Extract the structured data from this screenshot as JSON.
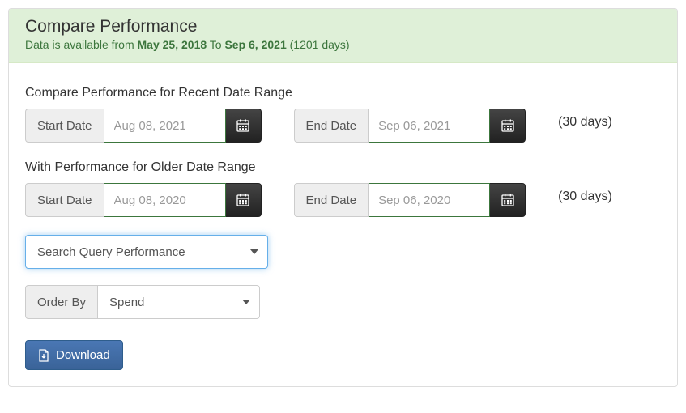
{
  "header": {
    "title": "Compare Performance",
    "data_prefix": "Data is available from ",
    "from_date": "May 25, 2018",
    "to_word": " To ",
    "to_date": "Sep 6, 2021",
    "days_suffix": " (1201 days)"
  },
  "recent": {
    "label": "Compare Performance for Recent Date Range",
    "start_label": "Start Date",
    "start_value": "Aug 08, 2021",
    "end_label": "End Date",
    "end_value": "Sep 06, 2021",
    "days": "(30 days)"
  },
  "older": {
    "label": "With Performance for Older Date Range",
    "start_label": "Start Date",
    "start_value": "Aug 08, 2020",
    "end_label": "End Date",
    "end_value": "Sep 06, 2020",
    "days": "(30 days)"
  },
  "query_select": {
    "selected": "Search Query Performance",
    "options": [
      "Search Query Performance"
    ]
  },
  "order_by": {
    "label": "Order By",
    "selected": "Spend",
    "options": [
      "Spend"
    ]
  },
  "download_label": "Download",
  "colors": {
    "header_bg": "#dff0d8",
    "header_text_green": "#3c763d",
    "date_border": "#3c763d",
    "btn_primary": "#3a6398"
  }
}
